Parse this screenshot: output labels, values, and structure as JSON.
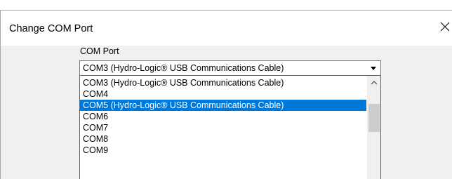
{
  "dialog": {
    "title": "Change COM Port",
    "close_icon": "close-icon"
  },
  "com_port": {
    "label": "COM Port",
    "selected_value": "COM3 (Hydro-Logic® USB Communications Cable)",
    "options": [
      "COM3 (Hydro-Logic® USB Communications Cable)",
      "COM4",
      "COM5 (Hydro-Logic® USB Communications Cable)",
      "COM6",
      "COM7",
      "COM8",
      "COM9"
    ],
    "highlighted_option": "COM5 (Hydro-Logic® USB Communications Cable)"
  },
  "colors": {
    "highlight": "#0078d7",
    "dialog_background": "#f0f0f0"
  }
}
